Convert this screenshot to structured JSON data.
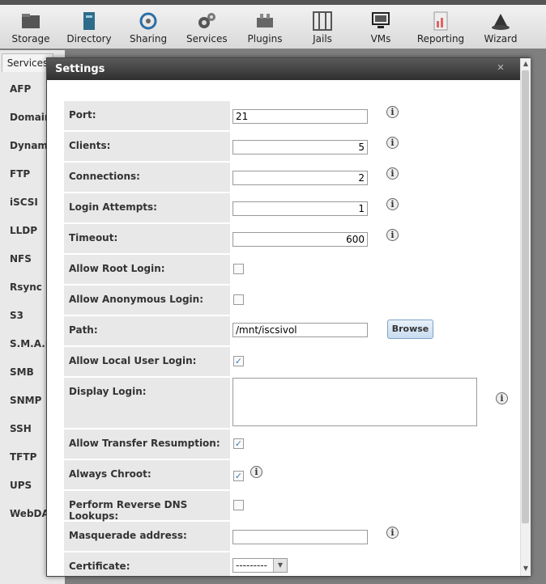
{
  "toolbar": {
    "items": [
      {
        "label": "Storage",
        "icon": "storage-icon"
      },
      {
        "label": "Directory",
        "icon": "directory-icon"
      },
      {
        "label": "Sharing",
        "icon": "sharing-icon"
      },
      {
        "label": "Services",
        "icon": "services-icon"
      },
      {
        "label": "Plugins",
        "icon": "plugins-icon"
      },
      {
        "label": "Jails",
        "icon": "jails-icon"
      },
      {
        "label": "VMs",
        "icon": "vms-icon"
      },
      {
        "label": "Reporting",
        "icon": "reporting-icon"
      },
      {
        "label": "Wizard",
        "icon": "wizard-icon"
      }
    ]
  },
  "left_panel": {
    "tab": "Services",
    "items": [
      "AFP",
      "Domain",
      "Dynami",
      "FTP",
      "iSCSI",
      "LLDP",
      "NFS",
      "Rsync",
      "S3",
      "S.M.A.R",
      "SMB",
      "SNMP",
      "SSH",
      "TFTP",
      "UPS",
      "WebDA"
    ]
  },
  "modal": {
    "title": "Settings",
    "close_icon": "close-icon",
    "fields": {
      "port": {
        "label": "Port:",
        "value": "21"
      },
      "clients": {
        "label": "Clients:",
        "value": "5"
      },
      "connections": {
        "label": "Connections:",
        "value": "2"
      },
      "login_attempts": {
        "label": "Login Attempts:",
        "value": "1"
      },
      "timeout": {
        "label": "Timeout:",
        "value": "600"
      },
      "allow_root_login": {
        "label": "Allow Root Login:",
        "checked": false
      },
      "allow_anonymous_login": {
        "label": "Allow Anonymous Login:",
        "checked": false
      },
      "path": {
        "label": "Path:",
        "value": "/mnt/iscsivol",
        "button": "Browse"
      },
      "allow_local_user_login": {
        "label": "Allow Local User Login:",
        "checked": true
      },
      "display_login": {
        "label": "Display Login:",
        "value": ""
      },
      "allow_transfer_resumption": {
        "label": "Allow Transfer Resumption:",
        "checked": true
      },
      "always_chroot": {
        "label": "Always Chroot:",
        "checked": true
      },
      "reverse_dns": {
        "label": "Perform Reverse DNS Lookups:",
        "checked": false
      },
      "masquerade_address": {
        "label": "Masquerade address:",
        "value": ""
      },
      "certificate": {
        "label": "Certificate:",
        "value": "---------"
      }
    }
  },
  "colors": {
    "title_bar": "#3a3a3a",
    "label_bg": "#e8e8e8",
    "check_accent": "#3b7bb8",
    "button_bg": "#c8dcf0"
  }
}
